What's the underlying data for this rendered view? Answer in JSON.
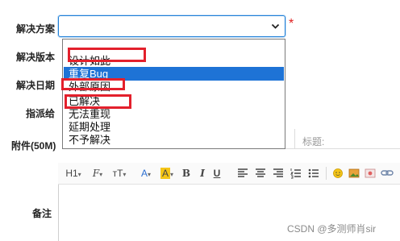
{
  "form": {
    "labels": {
      "solution": "解决方案",
      "build": "解决版本",
      "date": "解决日期",
      "assign": "指派给",
      "attachment": "附件(50M)",
      "remark": "备注"
    },
    "required_mark": "*",
    "title_placeholder": "标题:"
  },
  "dropdown": {
    "selected": "",
    "options": [
      "",
      "设计如此",
      "重复Bug",
      "外部原因",
      "已解决",
      "无法重现",
      "延期处理",
      "不予解决"
    ],
    "highlighted": "重复Bug"
  },
  "toolbar": {
    "heading": "H1",
    "font": "F",
    "font_size": "тT",
    "font_color": "A",
    "bg_color": "A",
    "bold": "B",
    "italic": "I",
    "underline": "U"
  },
  "colors": {
    "accent": "#1e73d6",
    "required": "#e02020",
    "highlight_box": "#e3202c",
    "highlight_bg": "#f5c518"
  },
  "watermark": "CSDN @多测师肖sir"
}
